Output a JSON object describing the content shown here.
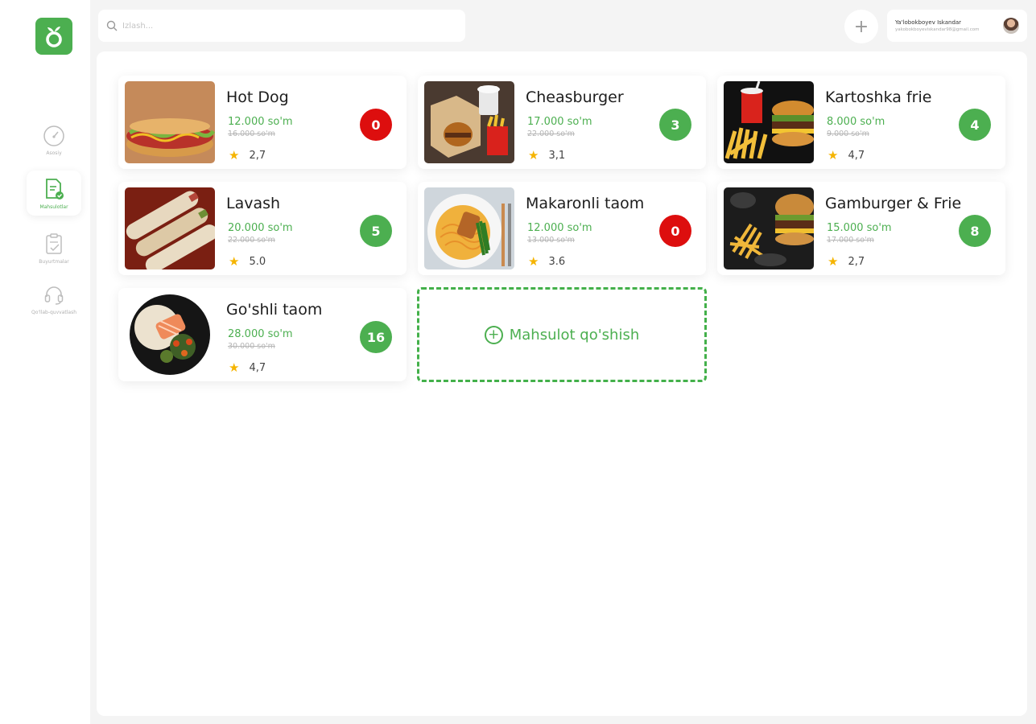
{
  "search": {
    "placeholder": "Izlash..."
  },
  "user": {
    "name": "Ya'lobokboyev Iskandar",
    "email": "yakobokboyeviskandar98@gmail.com"
  },
  "sidebar": {
    "items": [
      {
        "label": "Asosiy",
        "icon": "gauge-icon",
        "active": false
      },
      {
        "label": "Mahsulotlar",
        "icon": "document-icon",
        "active": true
      },
      {
        "label": "Buyurtmalar",
        "icon": "clipboard-icon",
        "active": false
      },
      {
        "label": "Qo'llab-quvvatlash",
        "icon": "headset-icon",
        "active": false
      }
    ]
  },
  "products": [
    {
      "name": "Hot Dog",
      "price": "12.000 so'm",
      "old_price": "16.000 so'm",
      "rating": "2,7",
      "count": "0",
      "status": "red"
    },
    {
      "name": "Cheasburger",
      "price": "17.000 so'm",
      "old_price": "22.000 so'm",
      "rating": "3,1",
      "count": "3",
      "status": "green"
    },
    {
      "name": "Kartoshka frie",
      "price": "8.000 so'm",
      "old_price": "9.000 so'm",
      "rating": "4,7",
      "count": "4",
      "status": "green"
    },
    {
      "name": "Lavash",
      "price": "20.000 so'm",
      "old_price": "22.000 so'm",
      "rating": "5.0",
      "count": "5",
      "status": "green"
    },
    {
      "name": "Makaronli taom",
      "price": "12.000 so'm",
      "old_price": "13.000 so'm",
      "rating": "3.6",
      "count": "0",
      "status": "red"
    },
    {
      "name": "Gamburger & Frie",
      "price": "15.000 so'm",
      "old_price": "17.000 so'm",
      "rating": "2,7",
      "count": "8",
      "status": "green"
    },
    {
      "name": "Go'shli taom",
      "price": "28.000 so'm",
      "old_price": "30.000 so'm",
      "rating": "4,7",
      "count": "16",
      "status": "green"
    }
  ],
  "add_product": {
    "label": "Mahsulot qo'shish"
  },
  "colors": {
    "accent": "#4caf50",
    "danger": "#dd0e0e",
    "star": "#f5b400"
  }
}
